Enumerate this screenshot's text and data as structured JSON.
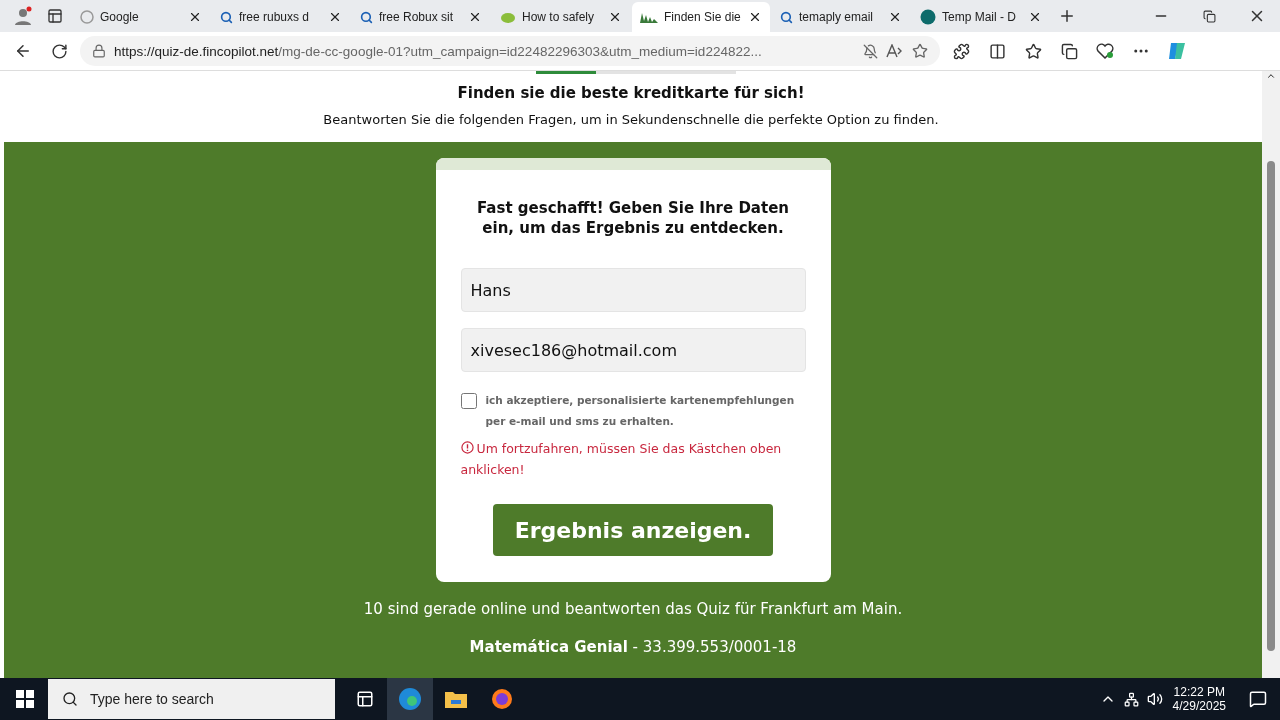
{
  "browser": {
    "tabs": [
      {
        "title": "Google",
        "kind": "google",
        "selected": false
      },
      {
        "title": "free rubuxs d",
        "kind": "search",
        "selected": false
      },
      {
        "title": "free Robux sit",
        "kind": "search",
        "selected": false
      },
      {
        "title": "How to safely",
        "kind": "leaf",
        "selected": false
      },
      {
        "title": "Finden Sie die",
        "kind": "wave",
        "selected": true
      },
      {
        "title": "temaply email",
        "kind": "search",
        "selected": false
      },
      {
        "title": "Temp Mail - D",
        "kind": "mail",
        "selected": false
      }
    ],
    "address": {
      "host": "https://quiz-de.fincopilot.net",
      "rest": "/mg-de-cc-google-01?utm_campaign=id22482296303&utm_medium=id224822..."
    }
  },
  "page": {
    "progress": {
      "level": 0.3
    },
    "heading": "Finden sie die beste kreditkarte für sich!",
    "subheading": "Beantworten Sie die folgenden Fragen, um in Sekundenschnelle die perfekte Option zu finden.",
    "card": {
      "title": "Fast geschafft! Geben Sie Ihre Daten ein, um das Ergebnis zu entdecken.",
      "name_value": "Hans",
      "email_value": "xivesec186@hotmail.com",
      "consent": {
        "label": "ich akzeptiere, personalisierte kartenempfehlungen per e-mail und sms zu erhalten.",
        "checked": false
      },
      "error": "Um fortzufahren, müssen Sie das Kästchen oben anklicken!",
      "button": "Ergebnis anzeigen."
    },
    "online_note": "10 sind gerade online und beantworten das Quiz für Frankfurt am Main.",
    "company": "**Matemática Genial** - 33.399.553/0001-18"
  },
  "taskbar": {
    "search_placeholder": "Type here to search",
    "time": "12:22 PM",
    "date": "4/29/2025"
  }
}
